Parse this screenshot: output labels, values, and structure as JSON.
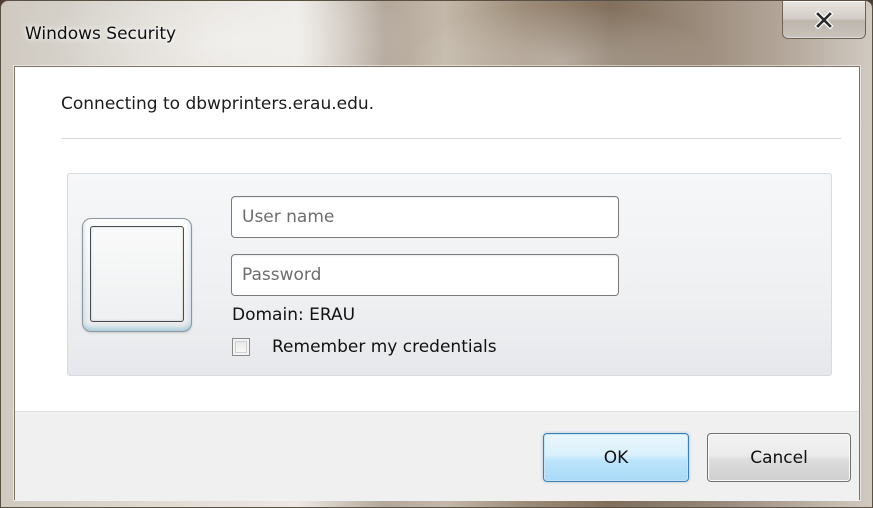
{
  "window": {
    "title": "Windows Security",
    "close_icon": "close-x-icon"
  },
  "dialog": {
    "connecting_text": "Connecting to dbwprinters.erau.edu.",
    "credentials": {
      "user_tile_icon": "user-tile-icon",
      "username": {
        "value": "",
        "placeholder": "User name"
      },
      "password": {
        "value": "",
        "placeholder": "Password"
      },
      "domain_text": "Domain: ERAU",
      "remember": {
        "label": "Remember my credentials",
        "checked": false
      }
    },
    "buttons": {
      "ok_label": "OK",
      "cancel_label": "Cancel"
    }
  },
  "colors": {
    "ok_button_border": "#3c7fb1",
    "client_background": "#ffffff",
    "footer_background": "#f0f0f0"
  }
}
